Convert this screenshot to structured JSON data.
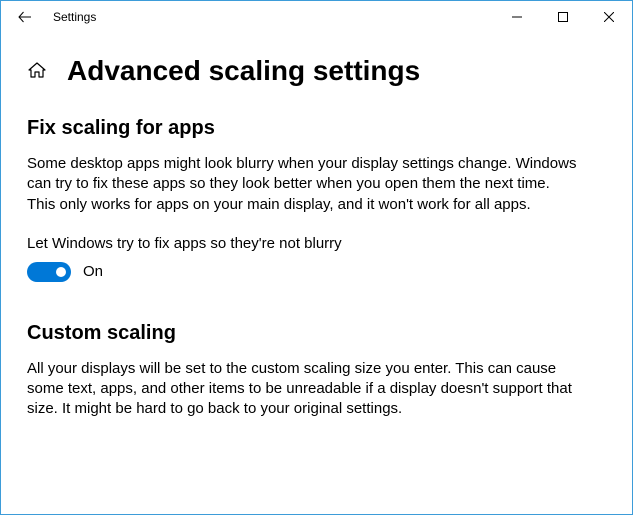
{
  "window": {
    "app_title": "Settings"
  },
  "header": {
    "title": "Advanced scaling settings"
  },
  "sections": {
    "fix_scaling": {
      "heading": "Fix scaling for apps",
      "description": "Some desktop apps might look blurry when your display settings change. Windows can try to fix these apps so they look better when you open them the next time. This only works for apps on your main display, and it won't work for all apps.",
      "toggle_label": "Let Windows try to fix apps so they're not blurry",
      "toggle_state": "On"
    },
    "custom_scaling": {
      "heading": "Custom scaling",
      "description": "All your displays will be set to the custom scaling size you enter. This can cause some text, apps, and other items to be unreadable if a display doesn't support that size. It might be hard to go back to your original settings."
    }
  }
}
